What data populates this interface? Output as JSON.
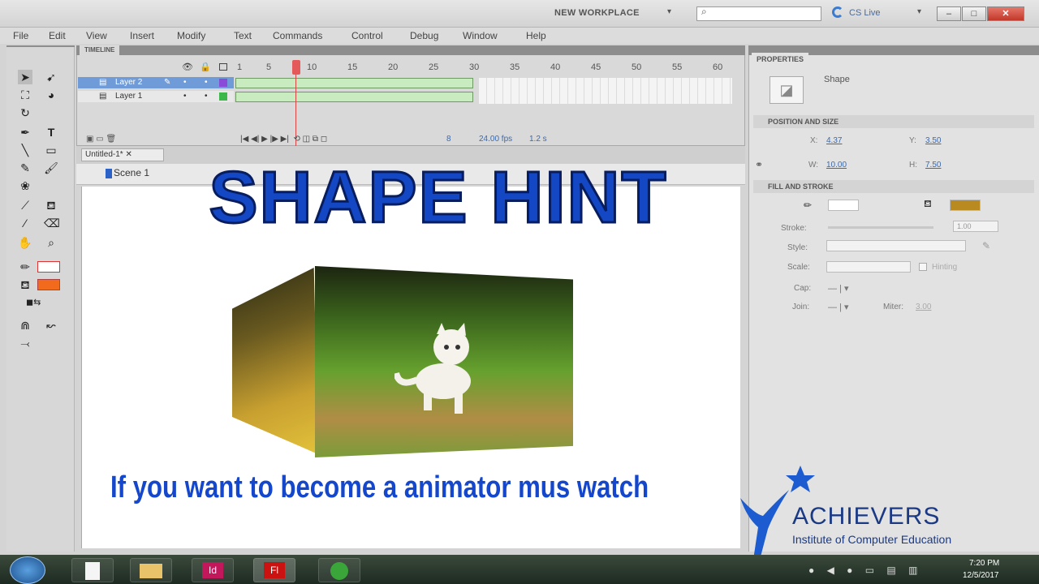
{
  "window": {
    "workspace": "NEW WORKPLACE",
    "cs_live": "CS Live",
    "minimize": "–",
    "maximize": "□",
    "close": "✕"
  },
  "menu": [
    "File",
    "Edit",
    "View",
    "Insert",
    "Modify",
    "Text",
    "Commands",
    "Control",
    "Debug",
    "Window",
    "Help"
  ],
  "timeline": {
    "tab": "TIMELINE",
    "frame_numbers": [
      "1",
      "5",
      "10",
      "15",
      "20",
      "25",
      "30",
      "35",
      "40",
      "45",
      "50",
      "55",
      "60"
    ],
    "layers": [
      {
        "name": "Layer 2"
      },
      {
        "name": "Layer 1"
      }
    ],
    "fps": "24.00 fps",
    "time": "1.2 s",
    "current_frame": "8"
  },
  "document": {
    "tab": "Untitled-1*",
    "scene": "Scene 1"
  },
  "overlay": {
    "title": "SHAPE HINT",
    "subtitle": "If you want to become a animator mus watch"
  },
  "properties": {
    "tab": "PROPERTIES",
    "object_type": "Shape",
    "position_section": "POSITION AND SIZE",
    "x_label": "X:",
    "x": "4.37",
    "y_label": "Y:",
    "y": "3.50",
    "w_label": "W:",
    "w": "10.00",
    "h_label": "H:",
    "h": "7.50",
    "fill_section": "FILL AND STROKE",
    "stroke_label": "Stroke:",
    "stroke": "1.00",
    "style_label": "Style:",
    "scale_label": "Scale:",
    "hinting_label": "Hinting",
    "cap_label": "Cap:",
    "join_label": "Join:",
    "miter_label": "Miter:",
    "miter": "3.00"
  },
  "taskbar": {
    "time": "7:20 PM",
    "date": "12/5/2017",
    "apps": [
      "Id",
      "Fl"
    ]
  },
  "watermark": {
    "name": "ACHIEVERS",
    "tagline": "Institute of Computer Education"
  },
  "colors": {
    "overlay_blue": "#1347c4",
    "tween_green": "#c8ecc0",
    "playhead_red": "#e45a5a",
    "fill_orange": "#f26a1b"
  }
}
